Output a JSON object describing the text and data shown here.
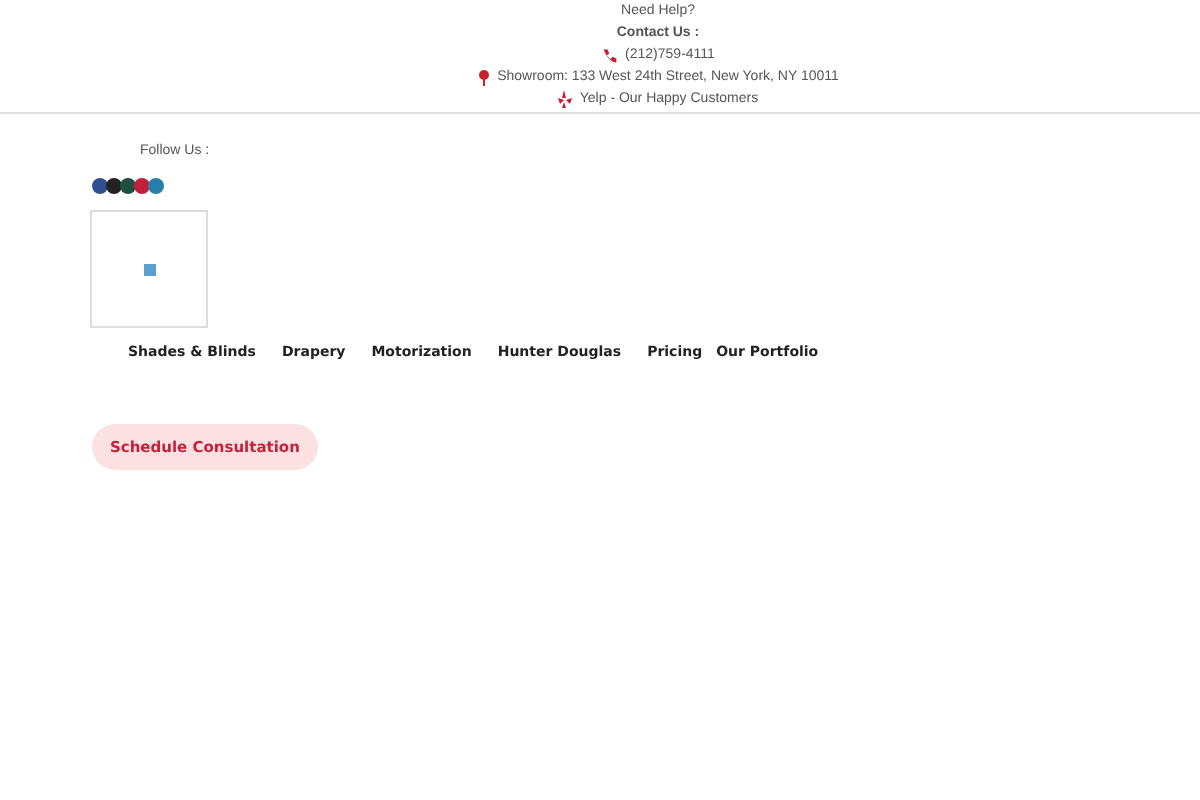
{
  "top_bar": {
    "help": "Need Help?",
    "contact_label": "Contact Us :",
    "phone": "(212)759-4111",
    "showroom": "Showroom: 133 West 24th Street, New York, NY 10011",
    "yelp": "Yelp - Our Happy Customers"
  },
  "follow_label": "Follow Us :",
  "social_icons": [
    {
      "color": "#2f4f8f"
    },
    {
      "color": "#222222"
    },
    {
      "color": "#1f4f3f"
    },
    {
      "color": "#c0203a"
    },
    {
      "color": "#2a7fa8"
    }
  ],
  "nav": [
    "Shades & Blinds",
    "Drapery",
    "Motorization",
    "Hunter Douglas",
    "Pricing",
    "Our Portfolio"
  ],
  "cta": "Schedule Consultation"
}
